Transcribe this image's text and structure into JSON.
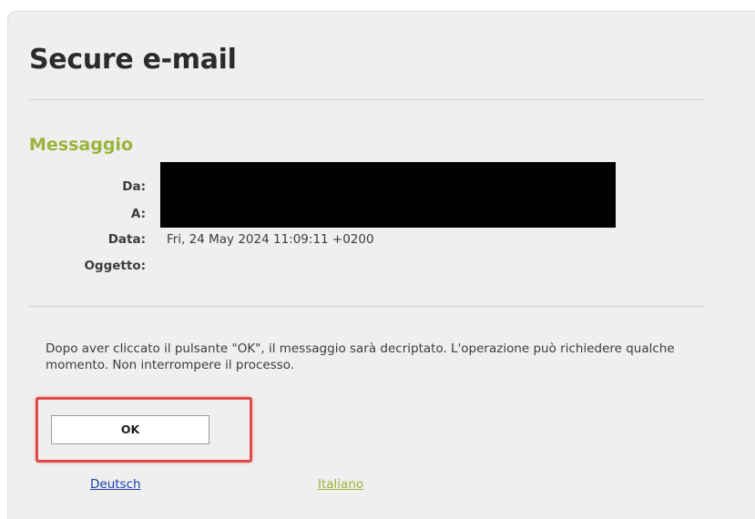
{
  "page": {
    "title": "Secure e-mail"
  },
  "message": {
    "section_title": "Messaggio",
    "fields": {
      "from_label": "Da:",
      "to_label": "A:",
      "date_label": "Data:",
      "date_value": "Fri, 24 May 2024 11:09:11 +0200",
      "subject_label": "Oggetto:"
    }
  },
  "notice": {
    "text": "Dopo aver cliccato il pulsante \"OK\", il messaggio sarà decriptato. L'operazione può richiedere qualche momento. Non interrompere il processo."
  },
  "actions": {
    "ok_label": "OK"
  },
  "languages": {
    "items": [
      {
        "label": "Deutsch",
        "active": false
      },
      {
        "label": "Italiano",
        "active": true
      }
    ],
    "link_color": "#1a3fb0",
    "active_color": "#9ab33a"
  },
  "colors": {
    "accent_green": "#9ab33a",
    "highlight_red": "#e04a4a",
    "panel_bg": "#efefef"
  }
}
